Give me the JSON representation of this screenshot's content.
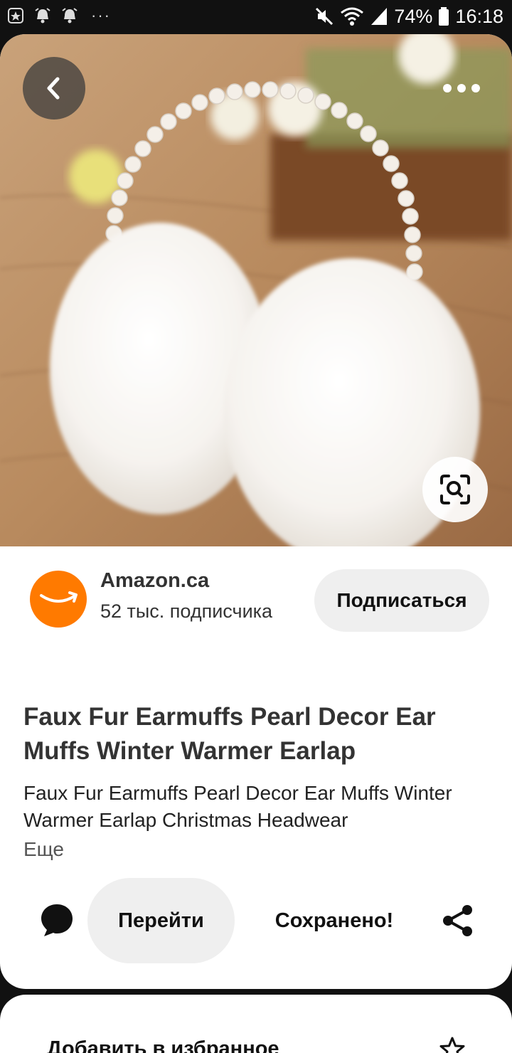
{
  "status_bar": {
    "battery": "74%",
    "time": "16:18"
  },
  "creator": {
    "name": "Amazon.ca",
    "followers": "52 тыс. подписчика",
    "subscribe_label": "Подписаться",
    "avatar_color": "#ff7a00"
  },
  "pin": {
    "title": "Faux Fur Earmuffs Pearl Decor Ear Muffs Winter Warmer Earlap",
    "description": "Faux Fur Earmuffs Pearl Decor Ear Muffs Winter Warmer Earlap Christmas Headwear",
    "more_label": "Еще"
  },
  "actions": {
    "visit_label": "Перейти",
    "saved_label": "Сохранено!"
  },
  "bottom_sheet": {
    "add_label": "Добавить в избранное"
  },
  "icons": {
    "back": "chevron-left-icon",
    "more": "more-dots-icon",
    "lens": "visual-search-icon",
    "comment": "comment-bubble-icon",
    "share": "share-icon",
    "star": "star-icon"
  }
}
